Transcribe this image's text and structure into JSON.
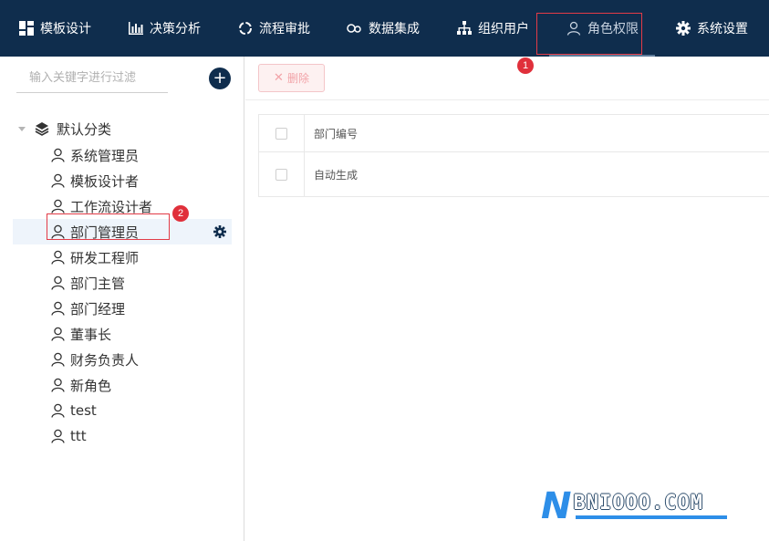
{
  "nav": {
    "items": [
      {
        "label": "模板设计",
        "icon": "dashboard-grid-icon"
      },
      {
        "label": "决策分析",
        "icon": "bar-chart-icon"
      },
      {
        "label": "流程审批",
        "icon": "circle-refresh-icon"
      },
      {
        "label": "数据集成",
        "icon": "link-icon"
      },
      {
        "label": "组织用户",
        "icon": "org-tree-icon"
      },
      {
        "label": "角色权限",
        "icon": "user-outline-icon"
      },
      {
        "label": "系统设置",
        "icon": "gear-icon"
      }
    ],
    "active_index": 5
  },
  "annotations": {
    "step1": "1",
    "step2": "2"
  },
  "left_panel": {
    "search_placeholder": "输入关键字进行过滤",
    "add_label": "+",
    "tree": {
      "root_label": "默认分类",
      "nodes": [
        "系统管理员",
        "模板设计者",
        "工作流设计者",
        "部门管理员",
        "研发工程师",
        "部门主管",
        "部门经理",
        "董事长",
        "财务负责人",
        "新角色",
        "test",
        "ttt"
      ],
      "selected_index": 3
    }
  },
  "right_panel": {
    "delete_label": "删除",
    "table": {
      "header": "部门编号",
      "rows": [
        "自动生成"
      ]
    }
  },
  "watermark": {
    "letter": "N",
    "text": "BNIOOO.COM"
  },
  "colors": {
    "nav_bg": "#0f2d4d",
    "highlight_red": "#e23b47",
    "selected_bg": "#eef4fb",
    "watermark_blue": "#2d8ee8"
  }
}
